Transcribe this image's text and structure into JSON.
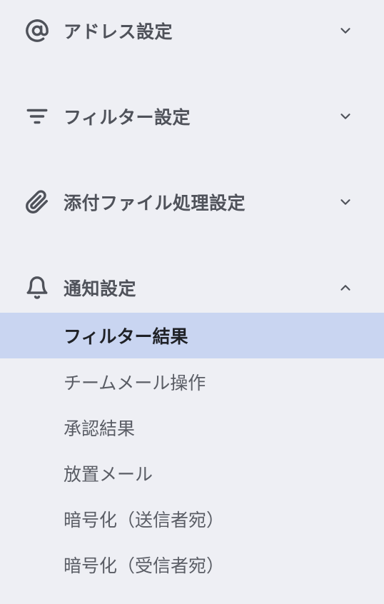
{
  "sections": [
    {
      "label": "アドレス設定",
      "icon": "at-sign-icon",
      "expanded": false
    },
    {
      "label": "フィルター設定",
      "icon": "filter-icon",
      "expanded": false
    },
    {
      "label": "添付ファイル処理設定",
      "icon": "paperclip-icon",
      "expanded": false
    },
    {
      "label": "通知設定",
      "icon": "bell-icon",
      "expanded": true
    }
  ],
  "notification_items": [
    {
      "label": "フィルター結果",
      "active": true
    },
    {
      "label": "チームメール操作",
      "active": false
    },
    {
      "label": "承認結果",
      "active": false
    },
    {
      "label": "放置メール",
      "active": false
    },
    {
      "label": "暗号化（送信者宛）",
      "active": false
    },
    {
      "label": "暗号化（受信者宛）",
      "active": false
    }
  ]
}
